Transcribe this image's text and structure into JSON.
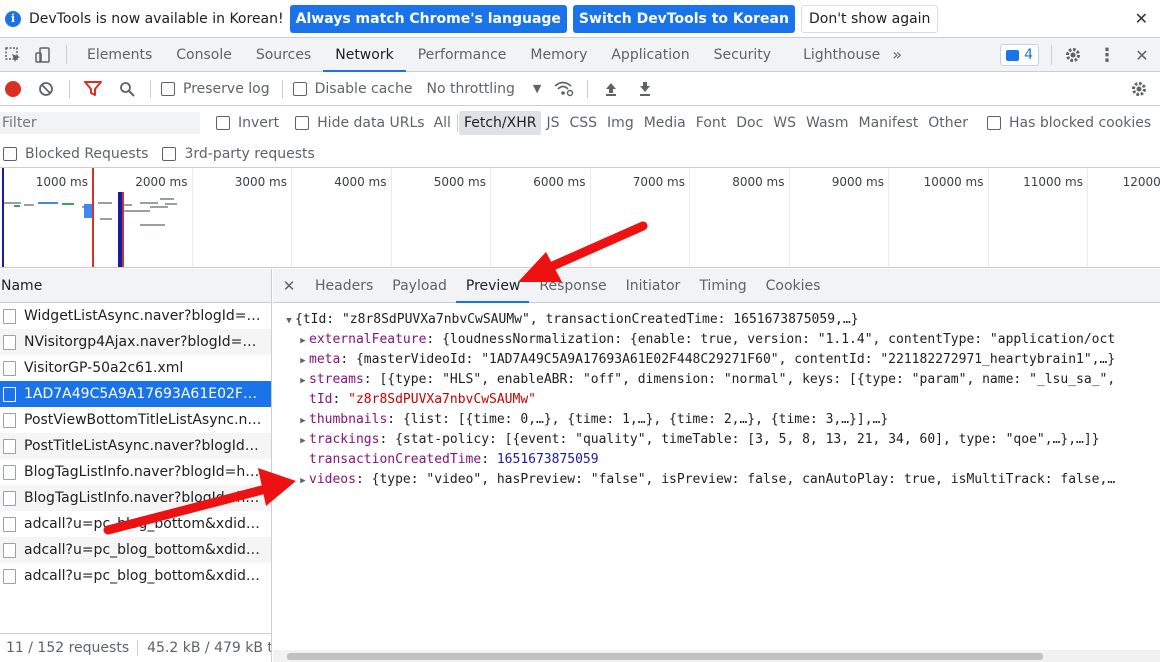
{
  "infobar": {
    "message": "DevTools is now available in Korean!",
    "match_language_button": "Always match Chrome's language",
    "switch_button": "Switch DevTools to Korean",
    "dismiss_button": "Don't show again"
  },
  "main_tabs": [
    "Elements",
    "Console",
    "Sources",
    "Network",
    "Performance",
    "Memory",
    "Application",
    "Security",
    "Lighthouse"
  ],
  "active_main_tab": "Network",
  "more_tabs": "»",
  "issues_count": "4",
  "network_toolbar": {
    "preserve_log": "Preserve log",
    "disable_cache": "Disable cache",
    "throttling": "No throttling"
  },
  "filter": {
    "placeholder": "Filter",
    "invert": "Invert",
    "hide_data_urls": "Hide data URLs",
    "types": [
      "All",
      "Fetch/XHR",
      "JS",
      "CSS",
      "Img",
      "Media",
      "Font",
      "Doc",
      "WS",
      "Wasm",
      "Manifest",
      "Other"
    ],
    "active_type": "Fetch/XHR",
    "has_blocked_cookies": "Has blocked cookies",
    "blocked_requests": "Blocked Requests",
    "third_party": "3rd-party requests"
  },
  "overview": {
    "ticks": [
      "1000 ms",
      "2000 ms",
      "3000 ms",
      "4000 ms",
      "5000 ms",
      "6000 ms",
      "7000 ms",
      "8000 ms",
      "9000 ms",
      "10000 ms",
      "11000 ms",
      "12000 ms"
    ]
  },
  "request_list": {
    "header": "Name",
    "rows": [
      "WidgetListAsync.naver?blogId=he...",
      "NVisitorgp4Ajax.naver?blogId=he...",
      "VisitorGP-50a2c61.xml",
      "1AD7A49C5A9A17693A61E02F448...",
      "PostViewBottomTitleListAsync.nav...",
      "PostTitleListAsync.naver?blogId=h...",
      "BlogTagListInfo.naver?blogId=hear...",
      "BlogTagListInfo.naver?blogId=hear...",
      "adcall?u=pc_blog_bottom&xdid=s...",
      "adcall?u=pc_blog_bottom&xdid=s...",
      "adcall?u=pc_blog_bottom&xdid=s..."
    ],
    "selected_index": 3,
    "status_requests": "11 / 152 requests",
    "status_transferred": "45.2 kB / 479 kB tra"
  },
  "detail_tabs": [
    "Headers",
    "Payload",
    "Preview",
    "Response",
    "Initiator",
    "Timing",
    "Cookies"
  ],
  "active_detail_tab": "Preview",
  "preview": {
    "root": "{tId: \"z8r8SdPUVXa7nbvCwSAUMw\", transactionCreatedTime: 1651673875059,…}",
    "lines": [
      {
        "key": "externalFeature",
        "value": "{loudnessNormalization: {enable: true, version: \"1.1.4\", contentType: \"application/oct",
        "expandable": true
      },
      {
        "key": "meta",
        "value": "{masterVideoId: \"1AD7A49C5A9A17693A61E02F448C29271F60\", contentId: \"221182272971_heartybrain1\",…}",
        "expandable": true
      },
      {
        "key": "streams",
        "value": "[{type: \"HLS\", enableABR: \"off\", dimension: \"normal\", keys: [{type: \"param\", name: \"_lsu_sa_\",",
        "expandable": true
      },
      {
        "key": "tId",
        "value": "\"z8r8SdPUVXa7nbvCwSAUMw\"",
        "expandable": false,
        "kind": "string"
      },
      {
        "key": "thumbnails",
        "value": "{list: [{time: 0,…}, {time: 1,…}, {time: 2,…}, {time: 3,…}],…}",
        "expandable": true
      },
      {
        "key": "trackings",
        "value": "{stat-policy: [{event: \"quality\", timeTable: [3, 5, 8, 13, 21, 34, 60], type: \"qoe\",…},…]}",
        "expandable": true
      },
      {
        "key": "transactionCreatedTime",
        "value": "1651673875059",
        "expandable": false,
        "kind": "number"
      },
      {
        "key": "videos",
        "value": "{type: \"video\", hasPreview: \"false\", isPreview: false, canAutoPlay: true, isMultiTrack: false,…",
        "expandable": true
      }
    ]
  },
  "colors": {
    "accent": "#1a73e8",
    "record": "#d93025",
    "annotation_arrow": "#ee1111"
  }
}
